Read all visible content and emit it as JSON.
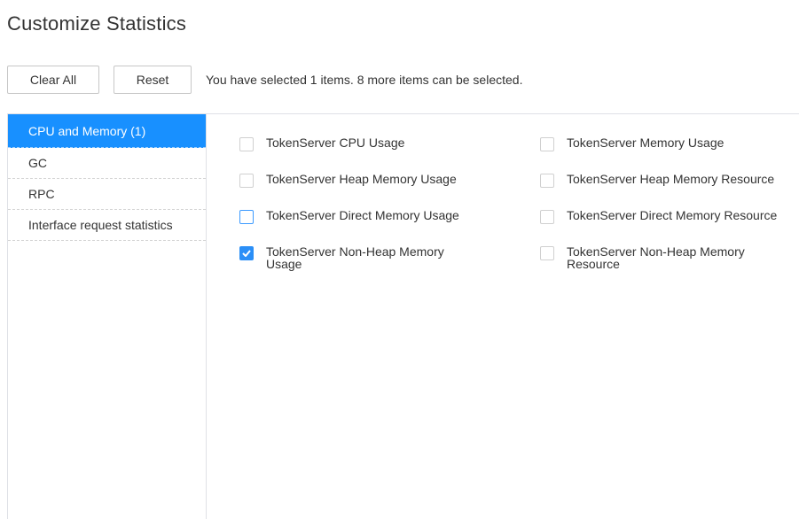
{
  "page": {
    "title": "Customize Statistics"
  },
  "toolbar": {
    "clear_label": "Clear All",
    "reset_label": "Reset",
    "selection_info": "You have selected 1 items. 8 more items can be selected."
  },
  "sidebar": {
    "items": [
      {
        "label": "CPU and Memory (1)",
        "active": true
      },
      {
        "label": "GC"
      },
      {
        "label": "RPC"
      },
      {
        "label": "Interface request statistics"
      }
    ]
  },
  "options": [
    {
      "label": "TokenServer CPU Usage",
      "checked": false
    },
    {
      "label": "TokenServer Memory Usage",
      "checked": false
    },
    {
      "label": "TokenServer Heap Memory Usage",
      "checked": false
    },
    {
      "label": "TokenServer Heap Memory Resource",
      "checked": false
    },
    {
      "label": "TokenServer Direct Memory Usage",
      "checked": false,
      "hovered": true
    },
    {
      "label": "TokenServer Direct Memory Resource",
      "checked": false
    },
    {
      "label": "TokenServer Non-Heap Memory Usage",
      "checked": true
    },
    {
      "label": "TokenServer Non-Heap Memory Resource",
      "checked": false
    }
  ],
  "colors": {
    "accent": "#1890ff",
    "checkbox_checked": "#2b8ff7",
    "text": "#333333"
  }
}
